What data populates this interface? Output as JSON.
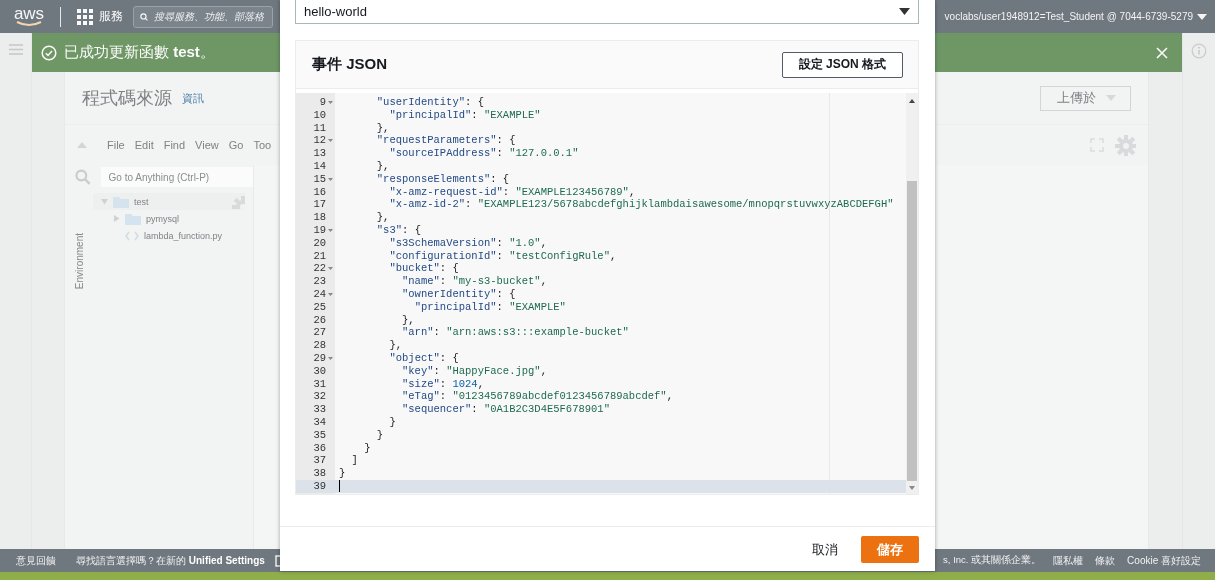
{
  "top_nav": {
    "logo": "aws",
    "services": "服務",
    "search": {
      "placeholder": "搜尋服務、功能、部落格"
    },
    "account": "voclabs/user1948912=Test_Student @ 7044-6739-5279"
  },
  "flash": {
    "message": "已成功更新函數 **test**。"
  },
  "code_source": {
    "title": "程式碼來源",
    "info_link": "資訊",
    "upload_button": "上傳於",
    "menu": [
      "File",
      "Edit",
      "Find",
      "View",
      "Go",
      "Too"
    ],
    "goto": {
      "placeholder": "Go to Anything (Ctrl-P)"
    },
    "environment_label": "Environment",
    "tree": [
      {
        "name": "test",
        "kind": "folder",
        "expanded": true,
        "children": [
          {
            "name": "pymysql",
            "kind": "folder",
            "expanded": false
          },
          {
            "name": "lambda_function.py",
            "kind": "file"
          }
        ]
      }
    ]
  },
  "footer": {
    "feedback": "意見回饋",
    "language_hint": "尋找語言選擇嗎？在新的 **Unified Settings**",
    "copyright": "s, Inc. 或其關係企業。",
    "links": [
      "隱私權",
      "條款",
      "Cookie 喜好設定"
    ]
  },
  "modal": {
    "event_select": {
      "value": "hello-world"
    },
    "editor": {
      "title": "事件 JSON",
      "format_button": "設定 JSON 格式",
      "lines": [
        {
          "number": "9",
          "text": "      \"userIdentity\": {",
          "foldable": true,
          "active": false
        },
        {
          "number": "10",
          "text": "        \"principalId\": \"EXAMPLE\"",
          "foldable": false,
          "active": false
        },
        {
          "number": "11",
          "text": "      },",
          "foldable": false,
          "active": false
        },
        {
          "number": "12",
          "text": "      \"requestParameters\": {",
          "foldable": true,
          "active": false
        },
        {
          "number": "13",
          "text": "        \"sourceIPAddress\": \"127.0.0.1\"",
          "foldable": false,
          "active": false
        },
        {
          "number": "14",
          "text": "      },",
          "foldable": false,
          "active": false
        },
        {
          "number": "15",
          "text": "      \"responseElements\": {",
          "foldable": true,
          "active": false
        },
        {
          "number": "16",
          "text": "        \"x-amz-request-id\": \"EXAMPLE123456789\",",
          "foldable": false,
          "active": false
        },
        {
          "number": "17",
          "text": "        \"x-amz-id-2\": \"EXAMPLE123/5678abcdefghijklambdaisawesome/mnopqrstuvwxyzABCDEFGH\"",
          "foldable": false,
          "active": false
        },
        {
          "number": "18",
          "text": "      },",
          "foldable": false,
          "active": false
        },
        {
          "number": "19",
          "text": "      \"s3\": {",
          "foldable": true,
          "active": false
        },
        {
          "number": "20",
          "text": "        \"s3SchemaVersion\": \"1.0\",",
          "foldable": false,
          "active": false
        },
        {
          "number": "21",
          "text": "        \"configurationId\": \"testConfigRule\",",
          "foldable": false,
          "active": false
        },
        {
          "number": "22",
          "text": "        \"bucket\": {",
          "foldable": true,
          "active": false
        },
        {
          "number": "23",
          "text": "          \"name\": \"my-s3-bucket\",",
          "foldable": false,
          "active": false
        },
        {
          "number": "24",
          "text": "          \"ownerIdentity\": {",
          "foldable": true,
          "active": false
        },
        {
          "number": "25",
          "text": "            \"principalId\": \"EXAMPLE\"",
          "foldable": false,
          "active": false
        },
        {
          "number": "26",
          "text": "          },",
          "foldable": false,
          "active": false
        },
        {
          "number": "27",
          "text": "          \"arn\": \"arn:aws:s3:::example-bucket\"",
          "foldable": false,
          "active": false
        },
        {
          "number": "28",
          "text": "        },",
          "foldable": false,
          "active": false
        },
        {
          "number": "29",
          "text": "        \"object\": {",
          "foldable": true,
          "active": false
        },
        {
          "number": "30",
          "text": "          \"key\": \"HappyFace.jpg\",",
          "foldable": false,
          "active": false
        },
        {
          "number": "31",
          "text": "          \"size\": 1024,",
          "foldable": false,
          "active": false
        },
        {
          "number": "32",
          "text": "          \"eTag\": \"0123456789abcdef0123456789abcdef\",",
          "foldable": false,
          "active": false
        },
        {
          "number": "33",
          "text": "          \"sequencer\": \"0A1B2C3D4E5F678901\"",
          "foldable": false,
          "active": false
        },
        {
          "number": "34",
          "text": "        }",
          "foldable": false,
          "active": false
        },
        {
          "number": "35",
          "text": "      }",
          "foldable": false,
          "active": false
        },
        {
          "number": "36",
          "text": "    }",
          "foldable": false,
          "active": false
        },
        {
          "number": "37",
          "text": "  ]",
          "foldable": false,
          "active": false
        },
        {
          "number": "38",
          "text": "}",
          "foldable": false,
          "active": false
        },
        {
          "number": "39",
          "foldable": false,
          "active": true
        }
      ]
    },
    "buttons": [
      {
        "label": "取消",
        "kind": "secondary"
      },
      {
        "label": "儲存",
        "kind": "primary"
      }
    ]
  }
}
